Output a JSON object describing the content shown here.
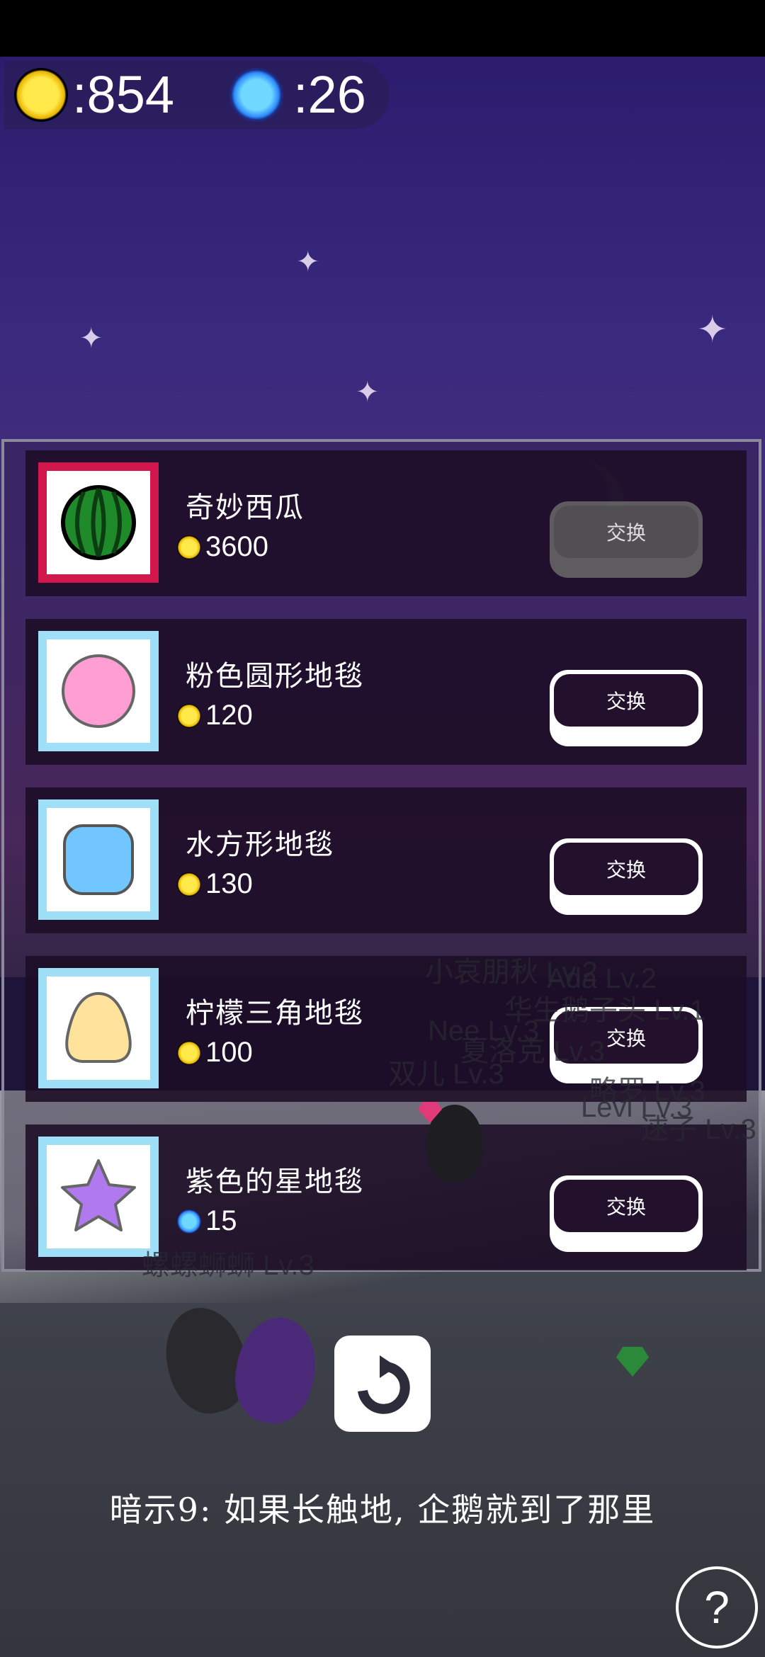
{
  "currency": {
    "gold_label": ":854",
    "gem_label": ":26"
  },
  "shop": {
    "items": [
      {
        "name": "奇妙西瓜",
        "price": "3600",
        "currency": "gold",
        "button": "交换",
        "selected": true,
        "icon": "watermelon-icon"
      },
      {
        "name": "粉色圆形地毯",
        "price": "120",
        "currency": "gold",
        "button": "交换",
        "selected": false,
        "icon": "pink-circle-rug-icon"
      },
      {
        "name": "水方形地毯",
        "price": "130",
        "currency": "gold",
        "button": "交换",
        "selected": false,
        "icon": "water-square-rug-icon"
      },
      {
        "name": "柠檬三角地毯",
        "price": "100",
        "currency": "gold",
        "button": "交换",
        "selected": false,
        "icon": "lemon-triangle-rug-icon"
      },
      {
        "name": "紫色的星地毯",
        "price": "15",
        "currency": "gem",
        "button": "交换",
        "selected": false,
        "icon": "purple-star-rug-icon"
      }
    ]
  },
  "players": [
    {
      "name": "小哀朋秋",
      "level": "Lv.2"
    },
    {
      "name": "Ada",
      "level": "Lv.2"
    },
    {
      "name": "华生鹅子头",
      "level": "Lv.1"
    },
    {
      "name": "Nee",
      "level": "Lv.3"
    },
    {
      "name": "夏洛克",
      "level": "Lv.3"
    },
    {
      "name": "双儿",
      "level": "Lv.3"
    },
    {
      "name": "略罗",
      "level": "Lv.3"
    },
    {
      "name": "Levi",
      "level": "Lv.3"
    },
    {
      "name": "逑子",
      "level": "Lv.3"
    },
    {
      "name": "螺螺蛳蛳",
      "level": "Lv.3"
    }
  ],
  "hint": "暗示9: 如果长触地, 企鹅就到了那里",
  "help_label": "?",
  "colors": {
    "gold": "#ffd800",
    "gem": "#3aa6ff",
    "selected_border": "#d2174e",
    "item_border": "#9fe0f8"
  }
}
